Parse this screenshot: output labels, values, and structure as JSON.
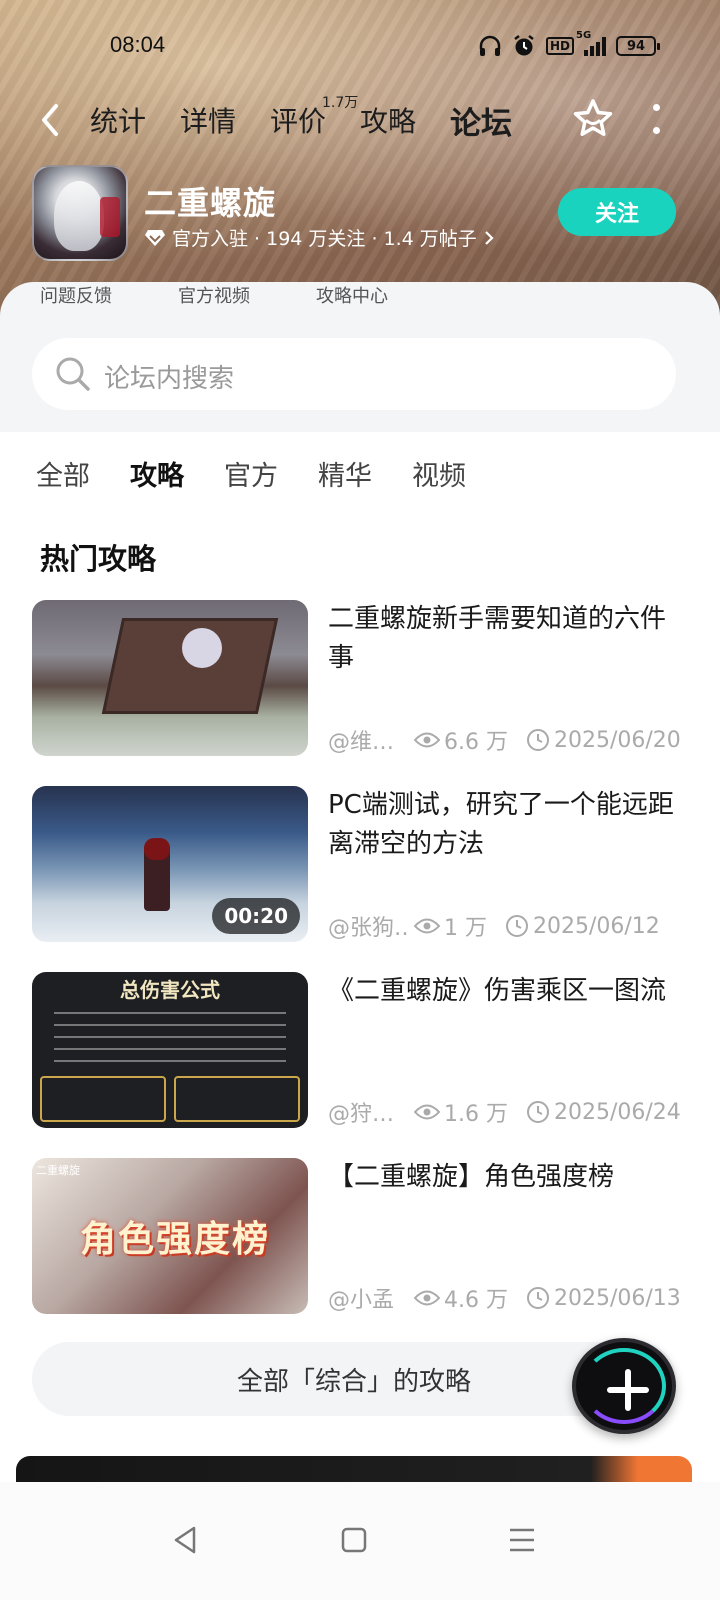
{
  "status": {
    "time": "08:04",
    "battery": "94",
    "network": "5G",
    "hd": "HD"
  },
  "nav": {
    "tabs": [
      "统计",
      "详情",
      "评价",
      "攻略",
      "论坛"
    ],
    "active_tab": "论坛",
    "review_badge": "1.7万"
  },
  "game": {
    "title": "二重螺旋",
    "meta": "官方入驻 · 194 万关注 · 1.4 万帖子",
    "follow_label": "关注"
  },
  "quick_links": [
    "问题反馈",
    "官方视频",
    "攻略中心"
  ],
  "search": {
    "placeholder": "论坛内搜索"
  },
  "categories": [
    "全部",
    "攻略",
    "官方",
    "精华",
    "视频"
  ],
  "active_category": "攻略",
  "section_title": "热门攻略",
  "posts": [
    {
      "title": "二重螺旋新手需要知道的六件事",
      "author": "@维…",
      "views": "6.6 万",
      "date": "2025/06/20"
    },
    {
      "title": "PC端测试，研究了一个能远距离滞空的方法",
      "author": "@张狗…",
      "views": "1 万",
      "date": "2025/06/12",
      "duration": "00:20"
    },
    {
      "title": "《二重螺旋》伤害乘区一图流",
      "author": "@狩…",
      "views": "1.6 万",
      "date": "2025/06/24",
      "thumb_title": "总伤害公式"
    },
    {
      "title": "【二重螺旋】角色强度榜",
      "author": "@小孟",
      "views": "4.6 万",
      "date": "2025/06/13",
      "thumb_text": "角色强度榜",
      "thumb_tag": "二重螺旋"
    }
  ],
  "all_button_label": "全部「综合」的攻略",
  "colors": {
    "accent": "#1fd3c0",
    "follow_bg": "#19d3bf"
  }
}
